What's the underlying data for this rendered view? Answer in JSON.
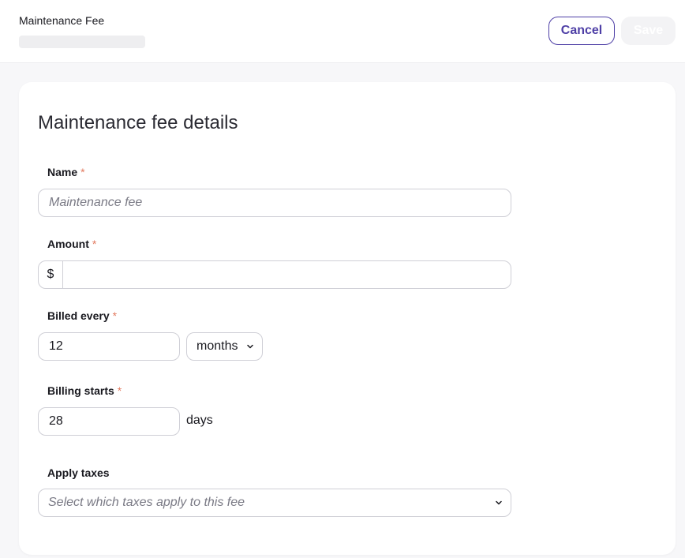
{
  "header": {
    "title": "Maintenance Fee",
    "cancel_label": "Cancel",
    "save_label": "Save"
  },
  "form": {
    "heading": "Maintenance fee details",
    "required_mark": "*",
    "name": {
      "label": "Name",
      "placeholder": "Maintenance fee",
      "value": ""
    },
    "amount": {
      "label": "Amount",
      "prefix": "$",
      "value": ""
    },
    "billed_every": {
      "label": "Billed every",
      "value": "12",
      "unit": "months"
    },
    "billing_starts": {
      "label": "Billing starts",
      "value": "28",
      "unit": "days"
    },
    "apply_taxes": {
      "label": "Apply taxes",
      "placeholder": "Select which taxes apply to this fee"
    }
  },
  "colors": {
    "accent": "#4e3fa6",
    "required": "#e27a5f",
    "border": "#cfcfd6"
  },
  "icons": {
    "months_select": "chevron-down-icon",
    "taxes_select": "chevron-down-icon"
  }
}
